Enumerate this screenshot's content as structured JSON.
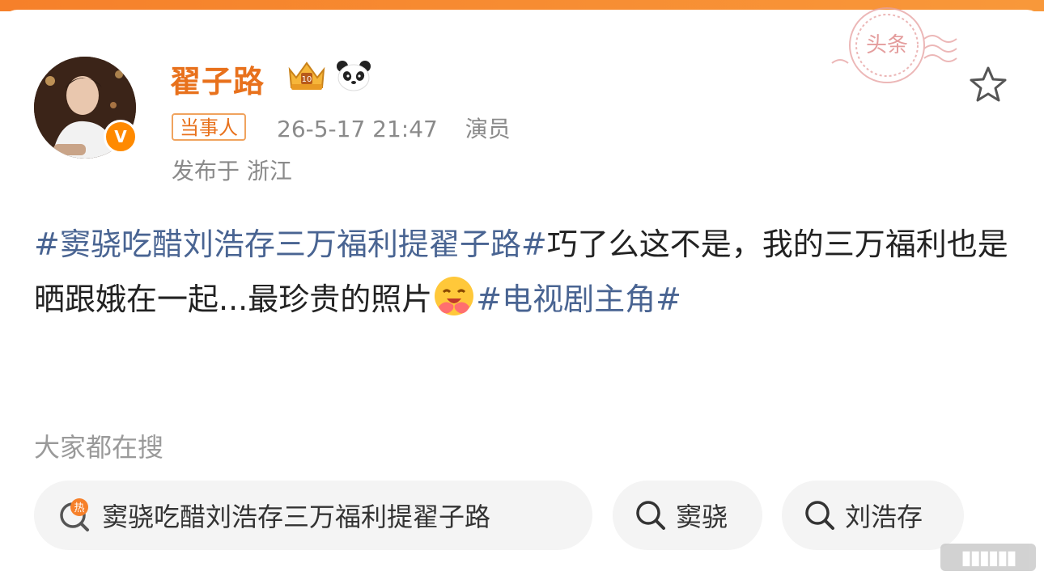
{
  "user": {
    "name": "翟子路",
    "tag": "当事人",
    "timestamp": "26-5-17 21:47",
    "role": "演员",
    "location": "发布于 浙江"
  },
  "stamp_text": "头条",
  "post": {
    "topic1": "#窦骁吃醋刘浩存三万福利提翟子路#",
    "text1": "巧了么这不是，我的三万福利也是晒跟娥在一起...最珍贵的照片",
    "topic2": "#电视剧主角#"
  },
  "search_section": {
    "title": "大家都在搜",
    "chips": [
      {
        "label": "窦骁吃醋刘浩存三万福利提翟子路",
        "icon": "hot-search-icon"
      },
      {
        "label": "窦骁",
        "icon": "search-icon"
      },
      {
        "label": "刘浩存",
        "icon": "search-icon"
      }
    ]
  },
  "icons": [
    "crown-badge-icon",
    "panda-icon",
    "star-icon",
    "verified-v-icon",
    "hugging-face-emoji"
  ],
  "colors": {
    "accent": "#e8711c",
    "topic": "#496492",
    "muted": "#8a8a8a",
    "chip_bg": "#f4f4f4"
  }
}
